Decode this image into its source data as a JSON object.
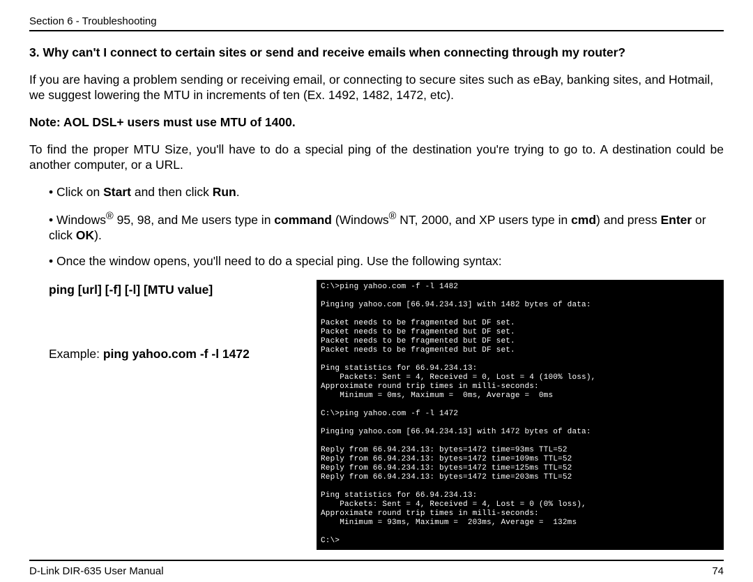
{
  "header": {
    "section": "Section 6 - Troubleshooting"
  },
  "q": {
    "num": "3.",
    "text": "Why can't I connect to certain sites or send and receive emails when connecting through my router?"
  },
  "p1": "If you are having a problem sending or receiving email, or connecting to secure sites such as eBay, banking sites, and Hotmail, we suggest lowering the MTU in increments of ten (Ex. 1492, 1482, 1472, etc).",
  "note": "Note: AOL DSL+ users must use MTU of 1400.",
  "p2": "To find the proper MTU Size, you'll have to do a special ping of the destination you're trying to go to. A destination could be another computer, or a URL.",
  "bullets": {
    "b1_pre": "• Click on ",
    "b1_start": "Start",
    "b1_mid": " and then click ",
    "b1_run": "Run",
    "b1_end": ".",
    "b2_pre": "• Windows",
    "b2_reg": "®",
    "b2_a": " 95, 98, and Me users type in ",
    "b2_cmd1": "command",
    "b2_b": " (Windows",
    "b2_c": " NT, 2000, and XP users type in ",
    "b2_cmd2": "cmd",
    "b2_d": ") and press ",
    "b2_enter": "Enter",
    "b2_e": " or click ",
    "b2_ok": "OK",
    "b2_f": ").",
    "b3": "• Once the window opens, you'll need to do a special ping. Use the following syntax:"
  },
  "syntax": " ping [url] [-f] [-l] [MTU value]",
  "example_pre": "Example: ",
  "example_bold": "ping yahoo.com -f -l 1472",
  "terminal": {
    "l0": "C:\\>ping yahoo.com -f -l 1482",
    "l1": "",
    "l2": "Pinging yahoo.com [66.94.234.13] with 1482 bytes of data:",
    "l3": "",
    "l4": "Packet needs to be fragmented but DF set.",
    "l5": "Packet needs to be fragmented but DF set.",
    "l6": "Packet needs to be fragmented but DF set.",
    "l7": "Packet needs to be fragmented but DF set.",
    "l8": "",
    "l9": "Ping statistics for 66.94.234.13:",
    "l10": "    Packets: Sent = 4, Received = 0, Lost = 4 (100% loss),",
    "l11": "Approximate round trip times in milli-seconds:",
    "l12": "    Minimum = 0ms, Maximum =  0ms, Average =  0ms",
    "l13": "",
    "l14": "C:\\>ping yahoo.com -f -l 1472",
    "l15": "",
    "l16": "Pinging yahoo.com [66.94.234.13] with 1472 bytes of data:",
    "l17": "",
    "l18": "Reply from 66.94.234.13: bytes=1472 time=93ms TTL=52",
    "l19": "Reply from 66.94.234.13: bytes=1472 time=109ms TTL=52",
    "l20": "Reply from 66.94.234.13: bytes=1472 time=125ms TTL=52",
    "l21": "Reply from 66.94.234.13: bytes=1472 time=203ms TTL=52",
    "l22": "",
    "l23": "Ping statistics for 66.94.234.13:",
    "l24": "    Packets: Sent = 4, Received = 4, Lost = 0 (0% loss),",
    "l25": "Approximate round trip times in milli-seconds:",
    "l26": "    Minimum = 93ms, Maximum =  203ms, Average =  132ms",
    "l27": "",
    "l28": "C:\\>"
  },
  "footer": {
    "left": "D-Link DIR-635 User Manual",
    "right": "74"
  }
}
